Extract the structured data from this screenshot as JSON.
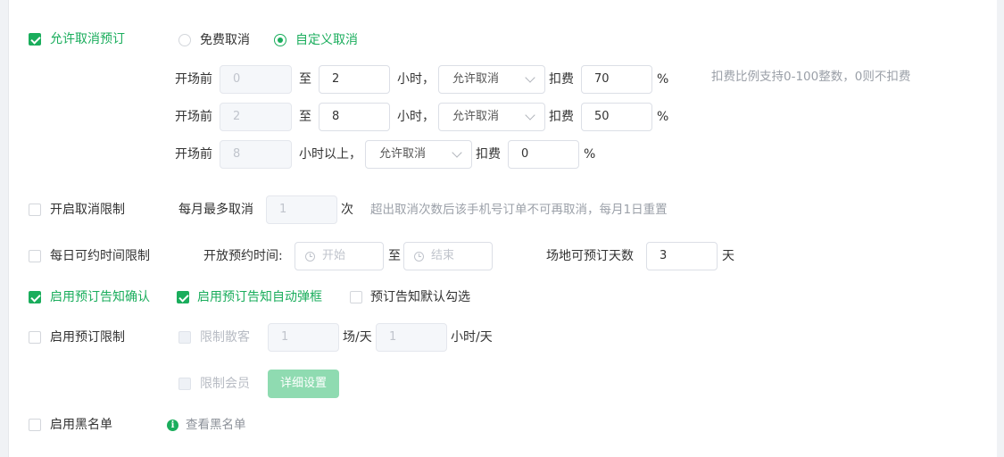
{
  "cancel": {
    "allow_label": "允许取消预订",
    "free_label": "免费取消",
    "custom_label": "自定义取消",
    "before_label": "开场前",
    "to_label": "至",
    "hours_label": "小时，",
    "hours_above_label": "小时以上，",
    "deduct_label": "扣费",
    "percent": "%",
    "hint": "扣费比例支持0-100整数，0则不扣费",
    "rows": [
      {
        "from": "0",
        "to": "2",
        "policy": "允许取消",
        "fee": "70"
      },
      {
        "from": "2",
        "to": "8",
        "policy": "允许取消",
        "fee": "50"
      },
      {
        "from": "8",
        "policy": "允许取消",
        "fee": "0"
      }
    ]
  },
  "limit": {
    "label": "开启取消限制",
    "monthly_label": "每月最多取消",
    "monthly_value": "1",
    "unit": "次",
    "hint": "超出取消次数后该手机号订单不可再取消，每月1日重置"
  },
  "daily": {
    "label": "每日可约时间限制",
    "open_time_label": "开放预约时间:",
    "start_placeholder": "开始",
    "to_label": "至",
    "end_placeholder": "结束",
    "days_label": "场地可预订天数",
    "days_value": "3",
    "days_unit": "天"
  },
  "notice": {
    "confirm_label": "启用预订告知确认",
    "popup_label": "启用预订告知自动弹框",
    "default_label": "预订告知默认勾选"
  },
  "booking_limit": {
    "label": "启用预订限制",
    "guest_label": "限制散客",
    "guest_count": "1",
    "guest_count_unit": "场/天",
    "guest_hours": "1",
    "guest_hours_unit": "小时/天",
    "member_label": "限制会员",
    "detail_button": "详细设置"
  },
  "blacklist": {
    "label": "启用黑名单",
    "view_link": "查看黑名单"
  },
  "colors": {
    "accent": "#1aad5c",
    "button_disabled": "#8fdbb1"
  },
  "icons": [
    "check-icon",
    "radio-dot-icon",
    "chevron-down-icon",
    "clock-icon",
    "info-icon"
  ]
}
